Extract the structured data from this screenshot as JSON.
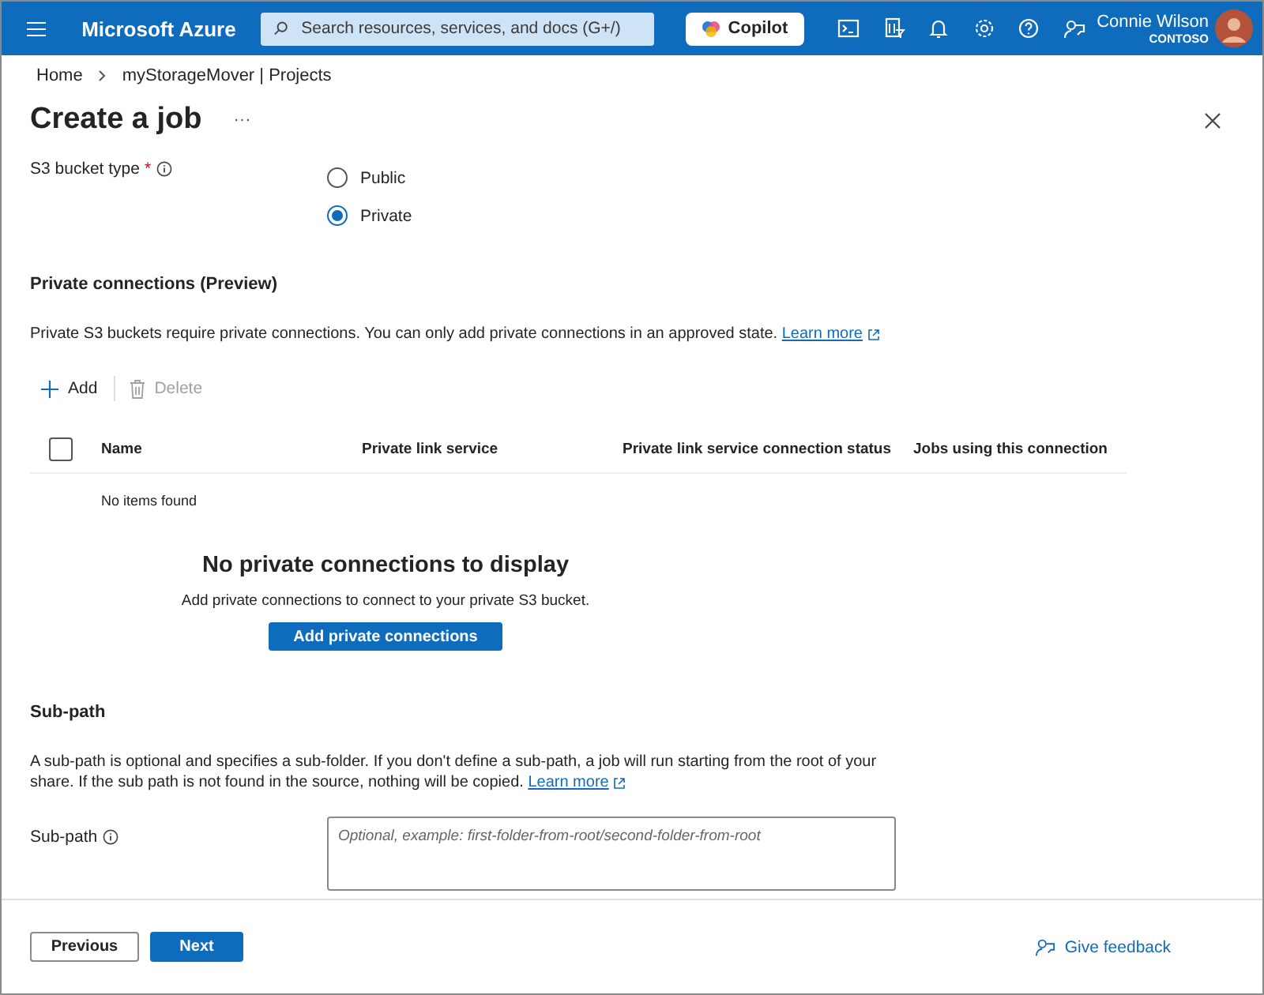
{
  "top_bar": {
    "brand": "Microsoft Azure",
    "search": {
      "placeholder": "Search resources, services, and docs (G+/)"
    },
    "copilot": "Copilot",
    "user": {
      "name": "Connie Wilson",
      "org": "CONTOSO"
    }
  },
  "breadcrumb": [
    "Home",
    "myStorageMover | Projects"
  ],
  "title": "Create a job",
  "more": "···",
  "bucket_type": {
    "label": "S3 bucket type",
    "required_mark": "*",
    "options": [
      {
        "label": "Public",
        "selected": false
      },
      {
        "label": "Private",
        "selected": true
      }
    ]
  },
  "private_connections": {
    "heading": "Private connections (Preview)",
    "description": "Private S3 buckets require private connections. You can only add private connections in an approved state.",
    "link": "Learn more",
    "toolbar": [
      {
        "label": "Add",
        "kind": "add",
        "disabled": false
      },
      {
        "label": "Delete",
        "kind": "delete",
        "disabled": true
      }
    ],
    "select_all": {
      "checked": false
    },
    "columns": [
      "Name",
      "Private link service",
      "Private link service connection status",
      "Jobs using this connection"
    ],
    "no_items": "No items found",
    "empty_title": "No private connections to display",
    "empty_text": "Add private connections to connect to your private S3 bucket.",
    "empty_button": "Add private connections"
  },
  "sub_path": {
    "heading": "Sub-path",
    "description": "A sub-path is optional and specifies a sub-folder. If you don't define a sub-path, a job will run starting from the root of your share. If the sub path is not found in the source, nothing will be copied.",
    "link": "Learn more",
    "label": "Sub-path",
    "placeholder": "Optional, example: first-folder-from-root/second-folder-from-root"
  },
  "footer": {
    "previous": "Previous",
    "next": "Next",
    "feedback": "Give feedback"
  }
}
